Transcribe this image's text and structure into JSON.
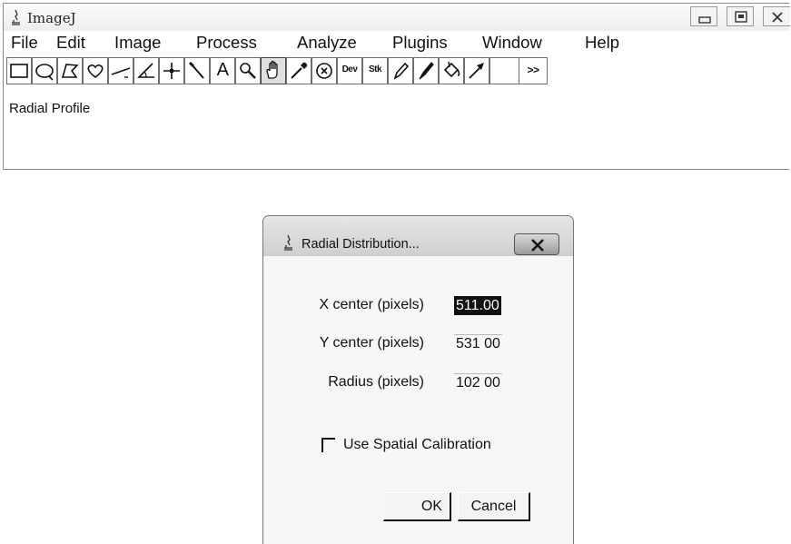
{
  "window": {
    "title": "ImageJ",
    "controls": [
      "minimize-icon",
      "maximize-icon",
      "close-icon"
    ]
  },
  "menu": [
    "File",
    "Edit",
    "Image",
    "Process",
    "Analyze",
    "Plugins",
    "Window",
    "Help"
  ],
  "toolbar": {
    "tools": [
      {
        "icon": "rectangle-icon"
      },
      {
        "icon": "oval-icon"
      },
      {
        "icon": "polygon-icon"
      },
      {
        "icon": "freehand-icon"
      },
      {
        "icon": "line-icon"
      },
      {
        "icon": "angle-icon"
      },
      {
        "icon": "point-icon"
      },
      {
        "icon": "wand-icon"
      },
      {
        "icon": "text-icon",
        "text": "A"
      },
      {
        "icon": "magnifier-icon"
      },
      {
        "icon": "hand-icon",
        "selected": true
      },
      {
        "icon": "dropper-icon"
      },
      {
        "icon": "macro-icon"
      },
      {
        "icon": "dev-icon",
        "text": "Dev"
      },
      {
        "icon": "stk-icon",
        "text": "Stk"
      },
      {
        "icon": "pencil-icon"
      },
      {
        "icon": "brush-icon"
      },
      {
        "icon": "flood-fill-icon"
      },
      {
        "icon": "arrow-icon"
      },
      {
        "icon": "blank-slot-icon"
      },
      {
        "icon": "more-tools-icon",
        "text": ">>"
      }
    ]
  },
  "status": {
    "text": "Radial Profile"
  },
  "dialog": {
    "title": "Radial Distribution...",
    "fields": [
      {
        "label": "X center (pixels)",
        "value": "511.00",
        "selected": true
      },
      {
        "label": "Y center (pixels)",
        "value": "531 00"
      },
      {
        "label": "Radius (pixels)",
        "value": "102 00"
      }
    ],
    "checkbox_label": "Use Spatial Calibration",
    "checkbox_checked": false,
    "ok_label": "OK",
    "cancel_label": "Cancel"
  }
}
